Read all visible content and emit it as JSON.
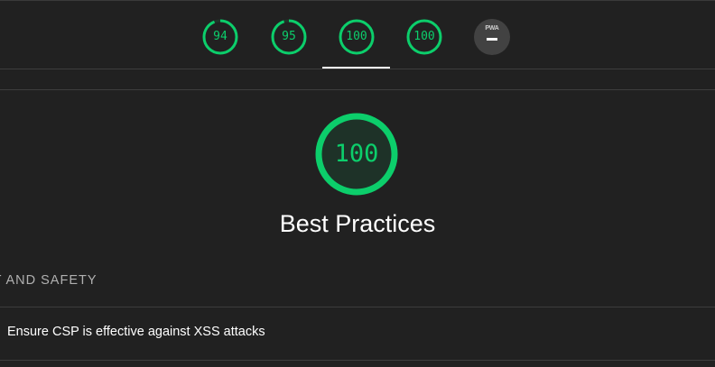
{
  "gauges": [
    {
      "label": "94",
      "score": 0.94,
      "color": "#0cce6b"
    },
    {
      "label": "95",
      "score": 0.95,
      "color": "#0cce6b"
    },
    {
      "label": "100",
      "score": 1.0,
      "color": "#0cce6b"
    },
    {
      "label": "100",
      "score": 1.0,
      "color": "#0cce6b"
    }
  ],
  "pwa": {
    "label": "PWA",
    "icon": "dash-icon"
  },
  "active_tab_index": 2,
  "category": {
    "score_label": "100",
    "score": 1.0,
    "title": "Best Practices",
    "color": "#0cce6b"
  },
  "group": {
    "title": "ST AND SAFETY"
  },
  "audits": [
    {
      "title": "Ensure CSP is effective against XSS attacks"
    }
  ],
  "colors": {
    "background": "#212121",
    "pass_green": "#0cce6b",
    "pwa_badge": "#424242"
  }
}
